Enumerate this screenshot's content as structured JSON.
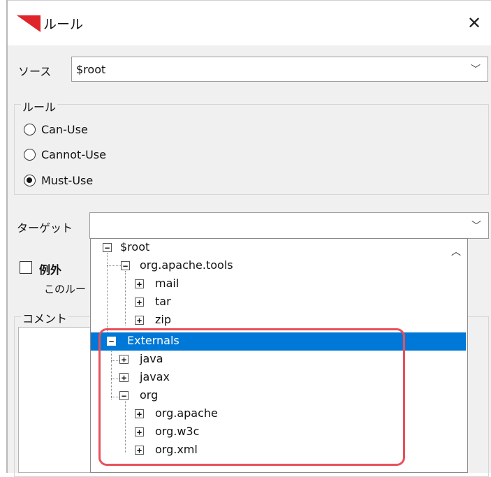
{
  "window": {
    "title": "ルール",
    "close_glyph": "✕"
  },
  "source": {
    "label": "ソース",
    "value": "$root"
  },
  "rule_group": {
    "title": "ルール",
    "options": [
      {
        "label": "Can-Use",
        "checked": false
      },
      {
        "label": "Cannot-Use",
        "checked": false
      },
      {
        "label": "Must-Use",
        "checked": true
      }
    ]
  },
  "target": {
    "label": "ターゲット",
    "value": ""
  },
  "exception": {
    "label": "例外",
    "checked": false,
    "description": "このルー"
  },
  "comment": {
    "label": "コメント"
  },
  "tree": {
    "nodes": [
      {
        "label": "$root",
        "expander": "−"
      },
      {
        "label": "org.apache.tools",
        "expander": "−"
      },
      {
        "label": "mail",
        "expander": "+"
      },
      {
        "label": "tar",
        "expander": "+"
      },
      {
        "label": "zip",
        "expander": "+"
      },
      {
        "label": "Externals",
        "expander": "−",
        "selected": true
      },
      {
        "label": "java",
        "expander": "+"
      },
      {
        "label": "javax",
        "expander": "+"
      },
      {
        "label": "org",
        "expander": "−"
      },
      {
        "label": "org.apache",
        "expander": "+"
      },
      {
        "label": "org.w3c",
        "expander": "+"
      },
      {
        "label": "org.xml",
        "expander": "+"
      }
    ]
  },
  "colors": {
    "selection": "#0078d7",
    "highlight": "#e8505b",
    "icon_red": "#e0242b"
  },
  "icons": {
    "dropdown": "chevron-down-icon",
    "scroll": "chevron-up-icon",
    "app": "red-triangle-icon"
  }
}
